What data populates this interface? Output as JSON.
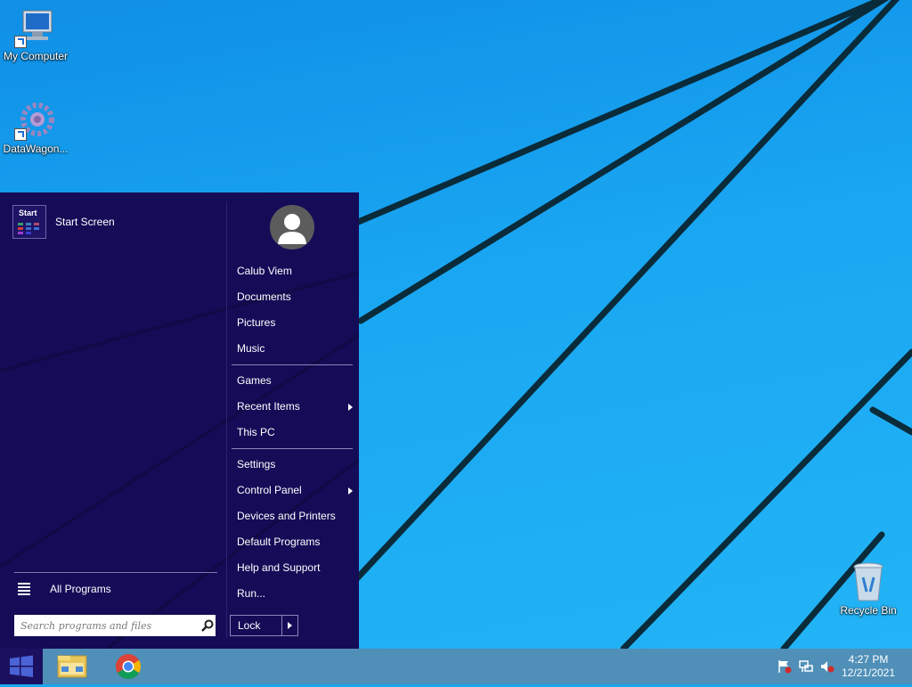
{
  "desktop": {
    "icons": [
      {
        "label": "My Computer",
        "icon": "computer-icon"
      },
      {
        "label": "DataWagon...",
        "icon": "datawagon-gear-icon"
      },
      {
        "label": "Recycle Bin",
        "icon": "recycle-bin-icon"
      }
    ]
  },
  "start_menu": {
    "start_screen": {
      "tile_label": "Start",
      "label": "Start Screen"
    },
    "all_programs_label": "All Programs",
    "search_placeholder": "Search programs and files",
    "user_icon": "user-avatar-icon",
    "items": [
      {
        "label": "Calub Viem",
        "submenu": false
      },
      {
        "label": "Documents",
        "submenu": false
      },
      {
        "label": "Pictures",
        "submenu": false
      },
      {
        "label": "Music",
        "submenu": false
      },
      {
        "label": "Games",
        "submenu": false
      },
      {
        "label": "Recent Items",
        "submenu": true
      },
      {
        "label": "This PC",
        "submenu": false
      },
      {
        "label": "Settings",
        "submenu": false
      },
      {
        "label": "Control Panel",
        "submenu": true
      },
      {
        "label": "Devices and Printers",
        "submenu": false
      },
      {
        "label": "Default Programs",
        "submenu": false
      },
      {
        "label": "Help and Support",
        "submenu": false
      },
      {
        "label": "Run...",
        "submenu": false
      }
    ],
    "lock_label": "Lock"
  },
  "taskbar": {
    "pinned": [
      {
        "name": "File Explorer",
        "icon": "file-explorer-icon"
      },
      {
        "name": "Google Chrome",
        "icon": "chrome-icon"
      }
    ],
    "tray_icons": [
      "action-center-flag-icon",
      "network-icon",
      "volume-muted-icon"
    ],
    "time": "4:27 PM",
    "date": "12/21/2021"
  },
  "colors": {
    "menu_bg": "#150c58",
    "taskbar_bg": "#4f8fb8",
    "desktop_bg": "#1aa6f0"
  }
}
